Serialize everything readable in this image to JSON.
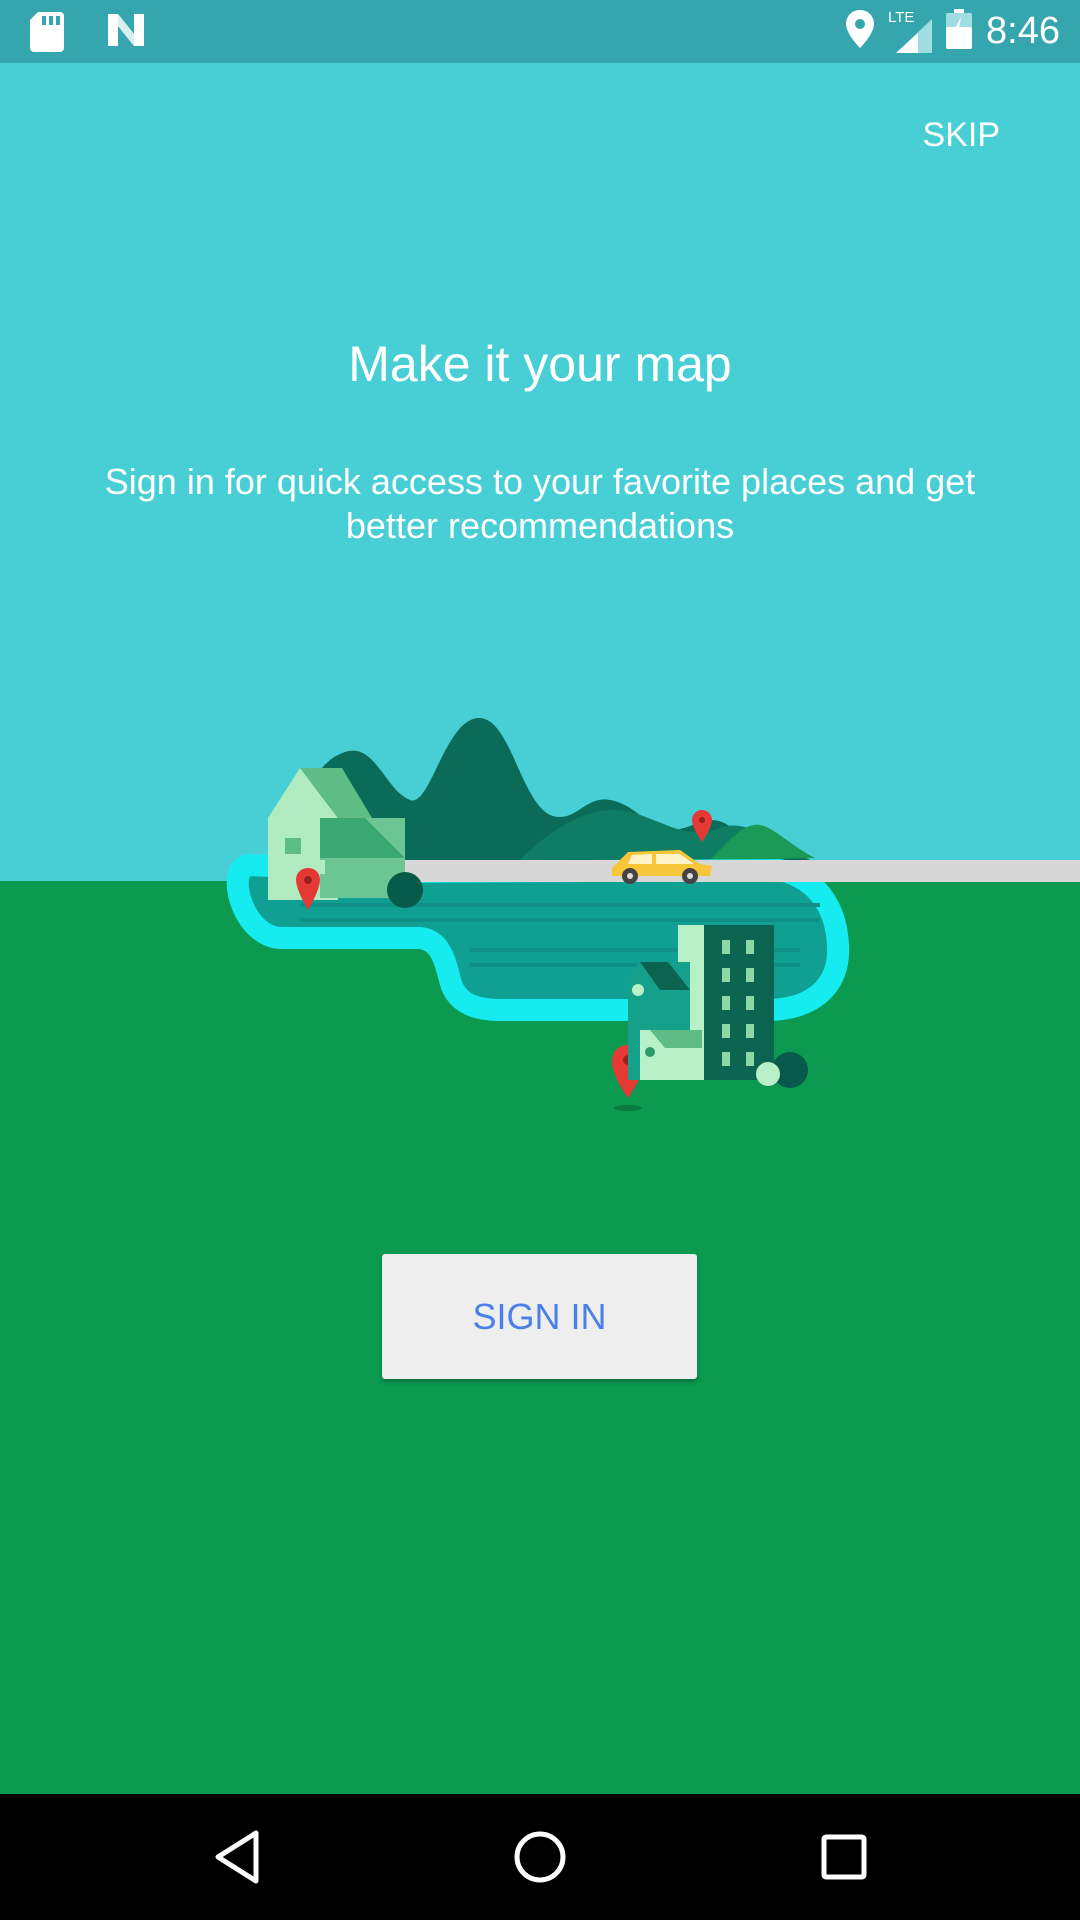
{
  "status_bar": {
    "time": "8:46",
    "network": "LTE",
    "icons": [
      "sd-card-icon",
      "n-logo-icon",
      "location-icon",
      "signal-icon",
      "battery-charging-icon"
    ]
  },
  "skip_label": "SKIP",
  "title": "Make it your map",
  "subtitle": "Sign in for quick access to your favorite places and get better recommendations",
  "sign_in_label": "SIGN IN",
  "nav_bar": {
    "icons": [
      "back-icon",
      "home-icon",
      "recents-icon"
    ]
  },
  "colors": {
    "sky": "#48cfd6",
    "ground": "#0b9a50",
    "status_bar": "#36a6ae",
    "button_text": "#4a80e8",
    "button_bg": "#eeeeee"
  }
}
